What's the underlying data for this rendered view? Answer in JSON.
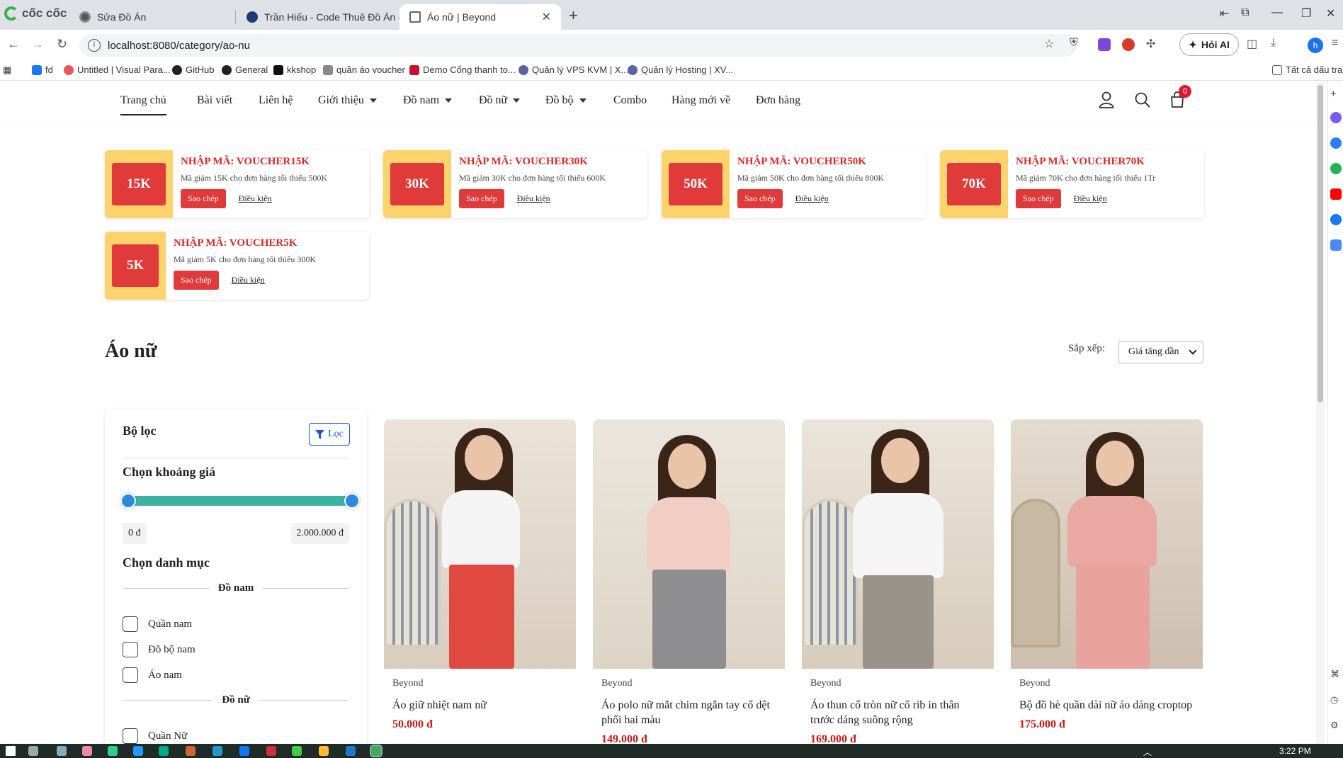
{
  "browser": {
    "brand": "cốc cốc",
    "tabs": [
      {
        "title": "Sửa Đồ Án"
      },
      {
        "title": "Trần Hiếu - Code Thuê Đồ Án - J"
      },
      {
        "title": "Áo nữ | Beyond"
      }
    ],
    "url": "localhost:8080/category/ao-nu",
    "ai_button": "Hỏi AI",
    "profile_initial": "h",
    "bookmarks": [
      "fd",
      "Untitled | Visual Para...",
      "GitHub",
      "General",
      "kkshop",
      "quần áo voucher",
      "Demo Cổng thanh to...",
      "Quản lý VPS KVM | X...",
      "Quản lý Hosting | XV...",
      "Tất cả dấu trang"
    ]
  },
  "nav": {
    "items": [
      {
        "label": "Trang chủ",
        "dropdown": false
      },
      {
        "label": "Bài viết",
        "dropdown": false
      },
      {
        "label": "Liên hệ",
        "dropdown": false
      },
      {
        "label": "Giới thiệu",
        "dropdown": true
      },
      {
        "label": "Đồ nam",
        "dropdown": true
      },
      {
        "label": "Đồ nữ",
        "dropdown": true
      },
      {
        "label": "Đồ bộ",
        "dropdown": true
      },
      {
        "label": "Combo",
        "dropdown": false
      },
      {
        "label": "Hàng mới về",
        "dropdown": false
      },
      {
        "label": "Đơn hàng",
        "dropdown": false
      }
    ],
    "cart_count": "0"
  },
  "vouchers": [
    {
      "amount": "15K",
      "code": "NHẬP MÃ: VOUCHER15K",
      "desc": "Mã giảm 15K cho đơn hàng tối thiểu 500K",
      "copy": "Sao chép",
      "cond": "Điều kiện"
    },
    {
      "amount": "30K",
      "code": "NHẬP MÃ: VOUCHER30K",
      "desc": "Mã giảm 30K cho đơn hàng tối thiểu 600K",
      "copy": "Sao chép",
      "cond": "Điều kiện"
    },
    {
      "amount": "50K",
      "code": "NHẬP MÃ: VOUCHER50K",
      "desc": "Mã giảm 50K cho đơn hàng tối thiểu 800K",
      "copy": "Sao chép",
      "cond": "Điều kiện"
    },
    {
      "amount": "70K",
      "code": "NHẬP MÃ: VOUCHER70K",
      "desc": "Mã giảm 70K cho đơn hàng tối thiểu 1Tr",
      "copy": "Sao chép",
      "cond": "Điều kiện"
    },
    {
      "amount": "5K",
      "code": "NHẬP MÃ: VOUCHER5K",
      "desc": "Mã giảm 5K cho đơn hàng tối thiểu 300K",
      "copy": "Sao chép",
      "cond": "Điều kiện"
    }
  ],
  "page": {
    "title": "Áo nữ",
    "sort_label": "Sắp xếp:",
    "sort_value": "Giá tăng dần"
  },
  "filter": {
    "title": "Bộ lọc",
    "button": "Lọc",
    "price_heading": "Chọn khoảng giá",
    "price_min": "0 đ",
    "price_max": "2.000.000 đ",
    "category_heading": "Chọn danh mục",
    "groups": [
      {
        "name": "Đồ nam",
        "options": [
          "Quần nam",
          "Đồ bộ nam",
          "Áo nam"
        ]
      },
      {
        "name": "Đồ nữ",
        "options": [
          "Quần Nữ"
        ]
      }
    ]
  },
  "products": [
    {
      "brand": "Beyond",
      "name": "Áo giữ nhiệt nam nữ",
      "price": "50.000 đ"
    },
    {
      "brand": "Beyond",
      "name": "Áo polo nữ mắt chim ngắn tay cổ dệt phối hai màu",
      "price": "149.000 đ"
    },
    {
      "brand": "Beyond",
      "name": "Áo thun cổ tròn nữ cổ rib in thân trước dáng suông rộng",
      "price": "169.000 đ"
    },
    {
      "brand": "Beyond",
      "name": "Bộ đồ hè quần dài nữ áo dáng croptop",
      "price": "175.000 đ"
    }
  ],
  "taskbar": {
    "time": "3:22 PM"
  }
}
